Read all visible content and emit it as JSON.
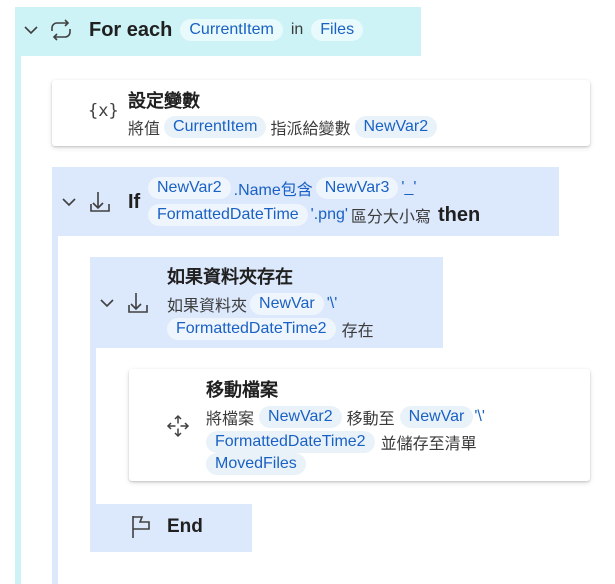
{
  "foreach": {
    "keyword": "For each",
    "item_var": "CurrentItem",
    "in_word": "in",
    "collection_var": "Files"
  },
  "set_variable": {
    "title": "設定變數",
    "prefix": "將值",
    "value_var": "CurrentItem",
    "middle": "指派給變數",
    "target_var": "NewVar2"
  },
  "if_block": {
    "keyword": "If",
    "var1": "NewVar2",
    "prop_text": ".Name包含",
    "var2": "NewVar3",
    "underscore_text": "'_'",
    "var3": "FormattedDateTime",
    "ext_text": "'.png'",
    "tail_text": "區分大小寫",
    "then_word": "then"
  },
  "if_folder": {
    "title": "如果資料夾存在",
    "prefix": "如果資料夾",
    "var1": "NewVar",
    "sep": "'\\'",
    "var2": "FormattedDateTime2",
    "suffix": "存在"
  },
  "move_file": {
    "title": "移動檔案",
    "prefix": "將檔案",
    "src_var": "NewVar2",
    "middle": "移動至",
    "dest_var": "NewVar",
    "sep": "'\\'",
    "dest_var2": "FormattedDateTime2",
    "list_text": "並儲存至清單",
    "list_var": "MovedFiles"
  },
  "end_block": {
    "label": "End"
  },
  "icons": {
    "foreach": "loop-icon",
    "variable": "variable-braces-icon",
    "if": "branch-icon",
    "move": "move-arrows-icon",
    "end": "flag-icon",
    "collapse": "chevron-down-icon"
  }
}
